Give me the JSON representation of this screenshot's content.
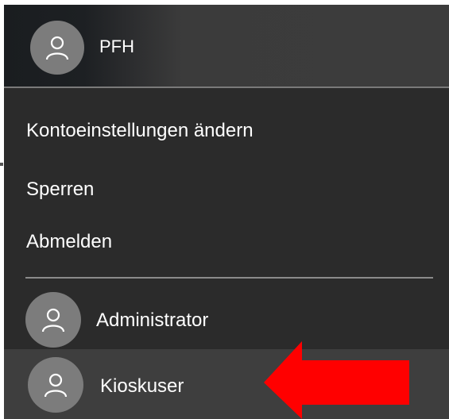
{
  "header": {
    "user_name": "PFH",
    "avatar_icon": "user-avatar-icon"
  },
  "menu": {
    "items": [
      {
        "label": "Kontoeinstellungen ändern"
      },
      {
        "label": "Sperren"
      },
      {
        "label": "Abmelden"
      }
    ]
  },
  "users": [
    {
      "name": "Administrator",
      "avatar_icon": "user-avatar-icon"
    },
    {
      "name": "Kioskuser",
      "avatar_icon": "user-avatar-icon",
      "highlighted": true
    }
  ],
  "annotation": {
    "icon": "red-arrow-icon",
    "color": "#ff0000",
    "points_to": "Kioskuser"
  },
  "colors": {
    "menu_background": "#2b2b2b",
    "header_background": "#3c3c3c",
    "hover_background": "#3e3e3e",
    "avatar": "#7c7c7c",
    "text": "#ffffff",
    "arrow": "#ff0000"
  }
}
